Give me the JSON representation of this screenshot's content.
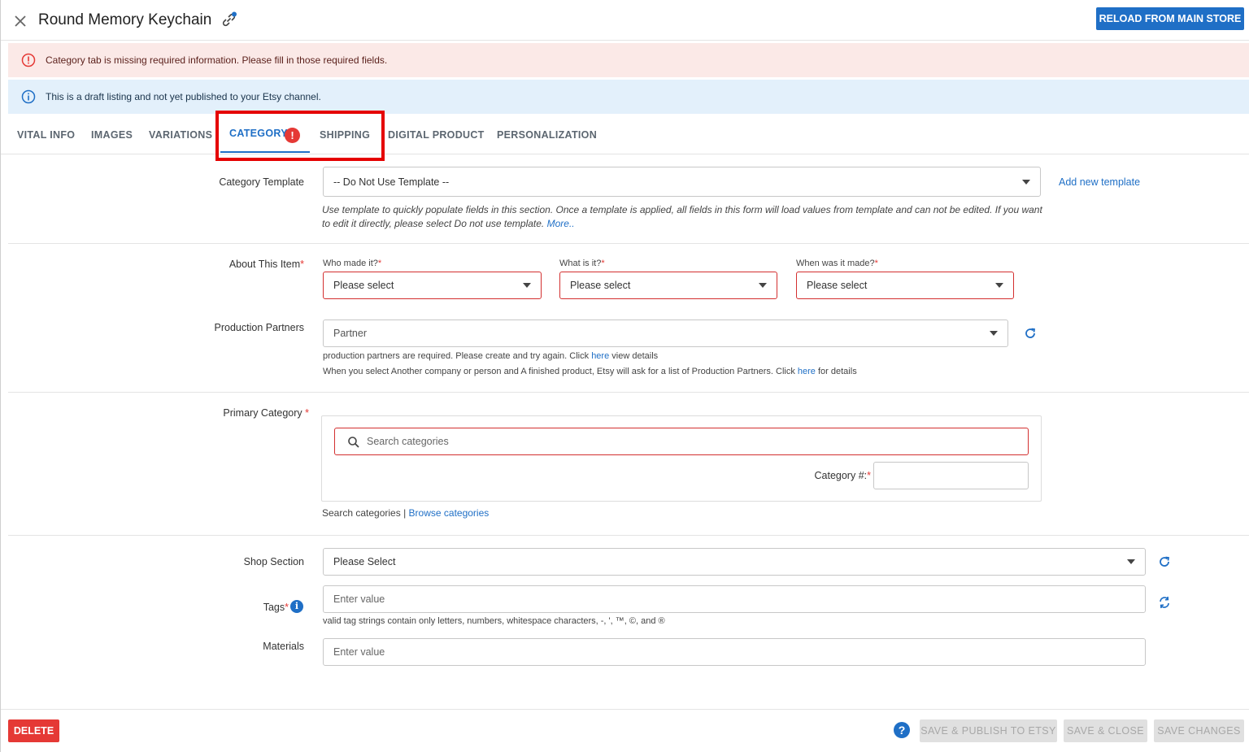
{
  "header": {
    "title": "Round Memory Keychain",
    "reload_label": "RELOAD FROM MAIN STORE"
  },
  "alerts": {
    "error": "Category tab is missing required information. Please fill in those required fields.",
    "info": "This is a draft listing and not yet published to your Etsy channel."
  },
  "tabs": [
    {
      "label": "VITAL INFO"
    },
    {
      "label": "IMAGES"
    },
    {
      "label": "VARIATIONS"
    },
    {
      "label": "CATEGORY",
      "active": true,
      "badge": "!"
    },
    {
      "label": "SHIPPING"
    },
    {
      "label": "DIGITAL PRODUCT"
    },
    {
      "label": "PERSONALIZATION"
    }
  ],
  "form": {
    "category_template": {
      "label": "Category Template",
      "value": "-- Do Not Use Template --",
      "add_link": "Add new template",
      "help": "Use template to quickly populate fields in this section. Once a template is applied, all fields in this form will load values from template and can not be edited. If you want to edit it directly, please select Do not use template.",
      "more": "More.."
    },
    "about": {
      "label": "About This Item",
      "who_label": "Who made it?",
      "who_value": "Please select",
      "what_label": "What is it?",
      "what_value": "Please select",
      "when_label": "When was it made?",
      "when_value": "Please select"
    },
    "production_partners": {
      "label": "Production Partners",
      "value": "Partner",
      "hint1_pre": "production partners are required. Please create and try again. Click",
      "hint1_link": "here",
      "hint1_post": "view details",
      "hint2_pre": "When you select Another company or person and A finished product, Etsy will ask for a list of Production Partners. Click",
      "hint2_link": "here",
      "hint2_post": "for details"
    },
    "primary_category": {
      "label": "Primary Category",
      "search_placeholder": "Search categories",
      "category_num_label": "Category #:",
      "category_num_value": "",
      "mode_search": "Search categories",
      "mode_separator": "|",
      "mode_browse": "Browse categories"
    },
    "shop_section": {
      "label": "Shop Section",
      "value": "Please Select"
    },
    "tags": {
      "label": "Tags",
      "placeholder": "Enter value",
      "hint": "valid tag strings contain only letters, numbers, whitespace characters, -, ', ™, ©, and ®"
    },
    "materials": {
      "label": "Materials",
      "placeholder": "Enter value"
    }
  },
  "footer": {
    "delete_label": "DELETE",
    "help_label": "?",
    "save_publish_label": "SAVE & PUBLISH TO ETSY",
    "save_close_label": "SAVE & CLOSE",
    "save_changes_label": "SAVE CHANGES"
  },
  "colors": {
    "accent": "#1f6fc6",
    "error": "#e53935",
    "error_bg": "#fbe9e7",
    "info_bg": "#e3f0fb",
    "highlight": "#e50000"
  }
}
